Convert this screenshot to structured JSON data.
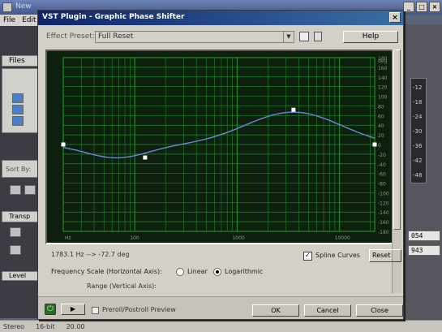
{
  "host": {
    "title": "New",
    "menu": [
      "File",
      "Edit"
    ],
    "left_tab": "Files",
    "sort_label": "Sort By:",
    "transport_label": "Transp",
    "level_label": "Level",
    "right_fields": [
      "054",
      "943"
    ],
    "meter_labels": [
      "-12",
      "-18",
      "-24",
      "-30",
      "-36",
      "-42",
      "-48"
    ],
    "status": [
      "Stereo",
      "16-bit",
      "20.00"
    ]
  },
  "dialog": {
    "title": "VST Plugin - Graphic Phase Shifter",
    "close_label": "×",
    "effect_preset_label": "Effect Preset:",
    "effect_preset_value": "Full Reset",
    "help_label": "Help",
    "readout": "1783.1 Hz --> -72.7 deg",
    "spline_label": "Spline Curves",
    "spline_checked": true,
    "reset_label": "Reset",
    "freq_scale_label": "Frequency Scale (Horizontal Axis):",
    "linear_label": "Linear",
    "log_label": "Logarithmic",
    "frequency_scale": "Logarithmic",
    "cutoff_text": "Range (Vertical Axis):",
    "play_label": "▶",
    "preroll_label": "Preroll/Postroll Preview",
    "ok_label": "OK",
    "cancel_label": "Cancel",
    "close_button_label": "Close"
  },
  "graph": {
    "y_ticks": [
      "180",
      "160",
      "140",
      "120",
      "100",
      "80",
      "60",
      "40",
      "20",
      "0",
      "-20",
      "-40",
      "-60",
      "-80",
      "-100",
      "-120",
      "-140",
      "-160",
      "-180"
    ],
    "y_unit": "deg",
    "x_ticks": [
      "Hz",
      "100",
      "1000",
      "10000"
    ],
    "control_points": [
      {
        "hz": 20,
        "deg": 0
      },
      {
        "hz": 126,
        "deg": -27
      },
      {
        "hz": 3550,
        "deg": 72
      },
      {
        "hz": 22050,
        "deg": 0
      }
    ],
    "colors": {
      "background": "#0d1f0d",
      "grid": "#1f8a2a",
      "curve": "#6a8ad8",
      "points": "#ffffff"
    }
  }
}
